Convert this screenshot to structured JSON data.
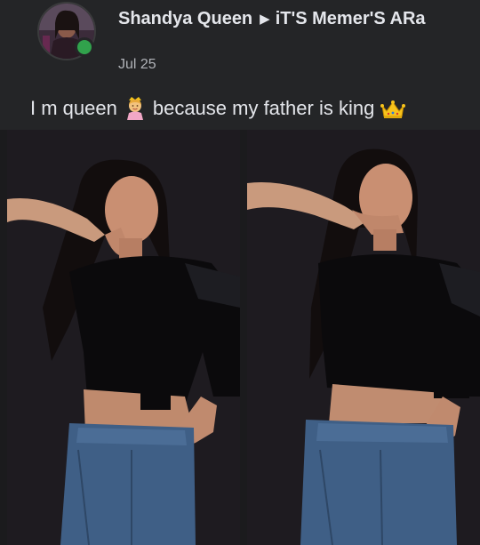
{
  "post": {
    "author": "Shandya Queen",
    "destination": "iT'S Memer'S ARa",
    "date": "Jul 25",
    "caption": {
      "part1": "I m queen",
      "part2": "because my father is king"
    },
    "icons": {
      "avatar": "profile-photo",
      "online_status": "online-dot",
      "shared_to": "triangle-right-icon",
      "emoji_1": "princess-emoji-icon",
      "emoji_2": "crown-emoji-icon"
    },
    "colors": {
      "background": "#242527",
      "text_primary": "#e4e6eb",
      "text_secondary": "#b0b3b8",
      "online": "#31a24c"
    }
  }
}
